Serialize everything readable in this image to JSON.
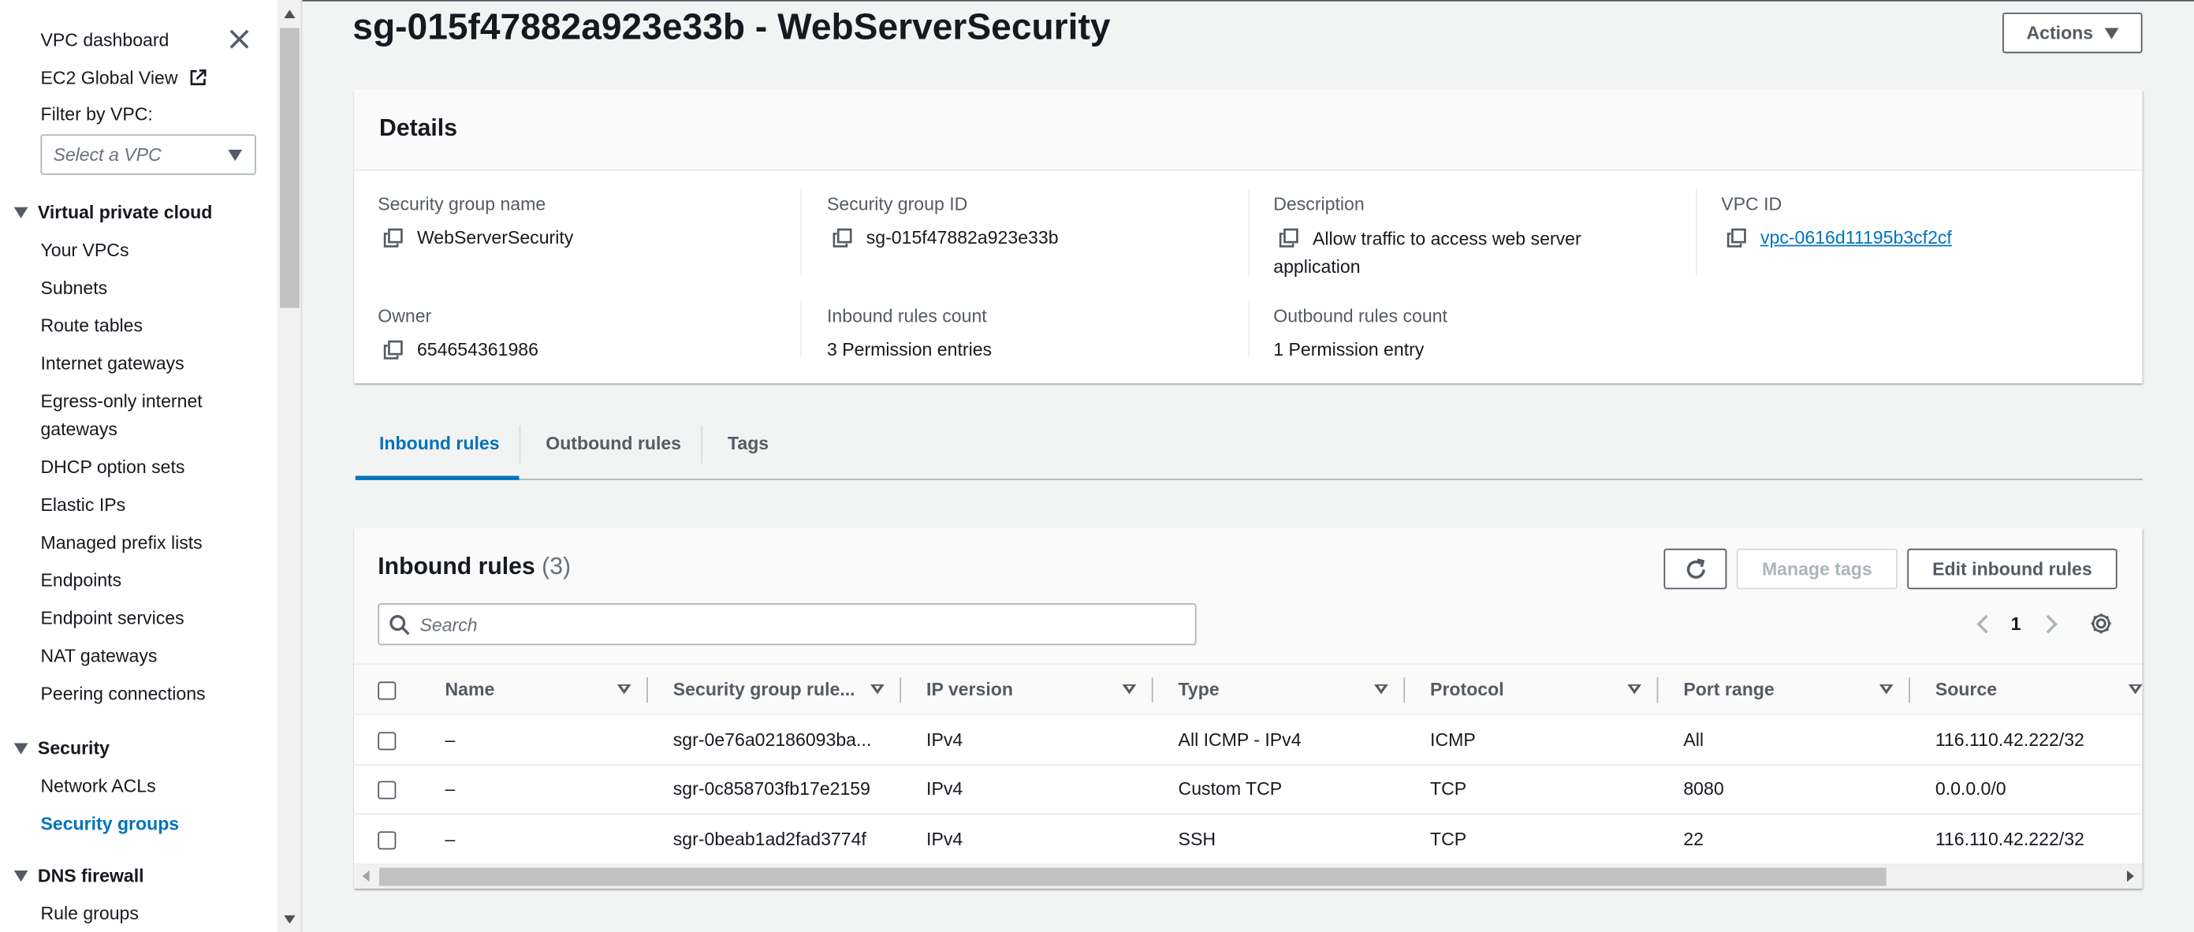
{
  "sidebar": {
    "vpc_dashboard": "VPC dashboard",
    "ec2_global_view": "EC2 Global View",
    "filter_label": "Filter by VPC:",
    "filter_placeholder": "Select a VPC",
    "sections": [
      {
        "title": "Virtual private cloud",
        "items": [
          "Your VPCs",
          "Subnets",
          "Route tables",
          "Internet gateways",
          "Egress-only internet gateways",
          "DHCP option sets",
          "Elastic IPs",
          "Managed prefix lists",
          "Endpoints",
          "Endpoint services",
          "NAT gateways",
          "Peering connections"
        ]
      },
      {
        "title": "Security",
        "items": [
          "Network ACLs",
          "Security groups"
        ]
      },
      {
        "title": "DNS firewall",
        "items": [
          "Rule groups"
        ]
      }
    ],
    "active_item": "Security groups"
  },
  "header": {
    "title": "sg-015f47882a923e33b - WebServerSecurity",
    "actions_label": "Actions"
  },
  "details": {
    "heading": "Details",
    "fields": {
      "sg_name": {
        "label": "Security group name",
        "value": "WebServerSecurity"
      },
      "sg_id": {
        "label": "Security group ID",
        "value": "sg-015f47882a923e33b"
      },
      "description": {
        "label": "Description",
        "value": "Allow traffic to access web server application"
      },
      "vpc_id": {
        "label": "VPC ID",
        "value": "vpc-0616d11195b3cf2cf"
      },
      "owner": {
        "label": "Owner",
        "value": "654654361986"
      },
      "inbound_count": {
        "label": "Inbound rules count",
        "value": "3 Permission entries"
      },
      "outbound_count": {
        "label": "Outbound rules count",
        "value": "1 Permission entry"
      }
    }
  },
  "tabs": [
    {
      "label": "Inbound rules",
      "active": true
    },
    {
      "label": "Outbound rules",
      "active": false
    },
    {
      "label": "Tags",
      "active": false
    }
  ],
  "rules": {
    "title": "Inbound rules",
    "count": "(3)",
    "manage_tags_label": "Manage tags",
    "edit_label": "Edit inbound rules",
    "search_placeholder": "Search",
    "page": "1",
    "columns": [
      "Name",
      "Security group rule...",
      "IP version",
      "Type",
      "Protocol",
      "Port range",
      "Source"
    ],
    "rows": [
      [
        "–",
        "sgr-0e76a02186093ba...",
        "IPv4",
        "All ICMP - IPv4",
        "ICMP",
        "All",
        "116.110.42.222/32"
      ],
      [
        "–",
        "sgr-0c858703fb17e2159",
        "IPv4",
        "Custom TCP",
        "TCP",
        "8080",
        "0.0.0.0/0"
      ],
      [
        "–",
        "sgr-0beab1ad2fad3774f",
        "IPv4",
        "SSH",
        "TCP",
        "22",
        "116.110.42.222/32"
      ]
    ]
  },
  "colors": {
    "accent": "#0073bb",
    "text": "#16191f",
    "muted": "#545b64",
    "background": "#f2f3f3"
  }
}
